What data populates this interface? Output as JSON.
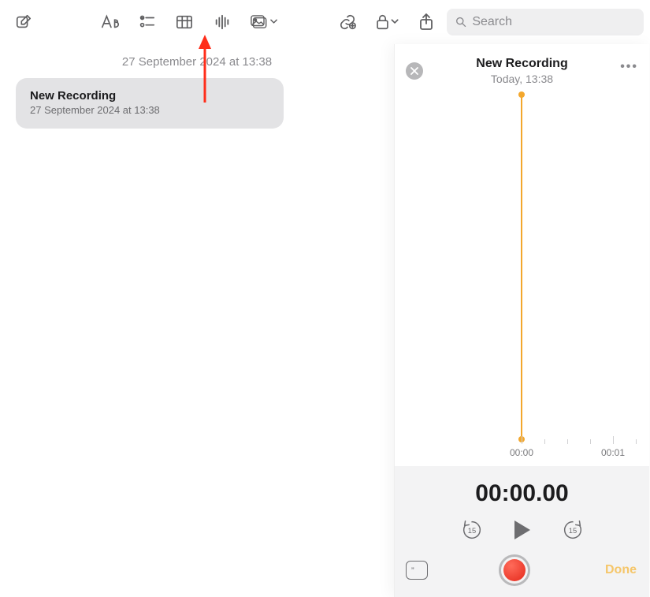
{
  "toolbar": {
    "search_placeholder": "Search"
  },
  "note": {
    "header_date": "27 September 2024 at 13:38",
    "title": "New Recording",
    "subtitle": "27 September 2024 at 13:38"
  },
  "recorder": {
    "title": "New Recording",
    "subtitle": "Today, 13:38",
    "tick_labels": {
      "zero": "00:00",
      "one": "00:01"
    },
    "elapsed": "00:00.00",
    "skip_back_label": "15",
    "skip_fwd_label": "15",
    "done_label": "Done"
  },
  "colors": {
    "accent": "#f3a72c",
    "record": "#e5291b"
  }
}
